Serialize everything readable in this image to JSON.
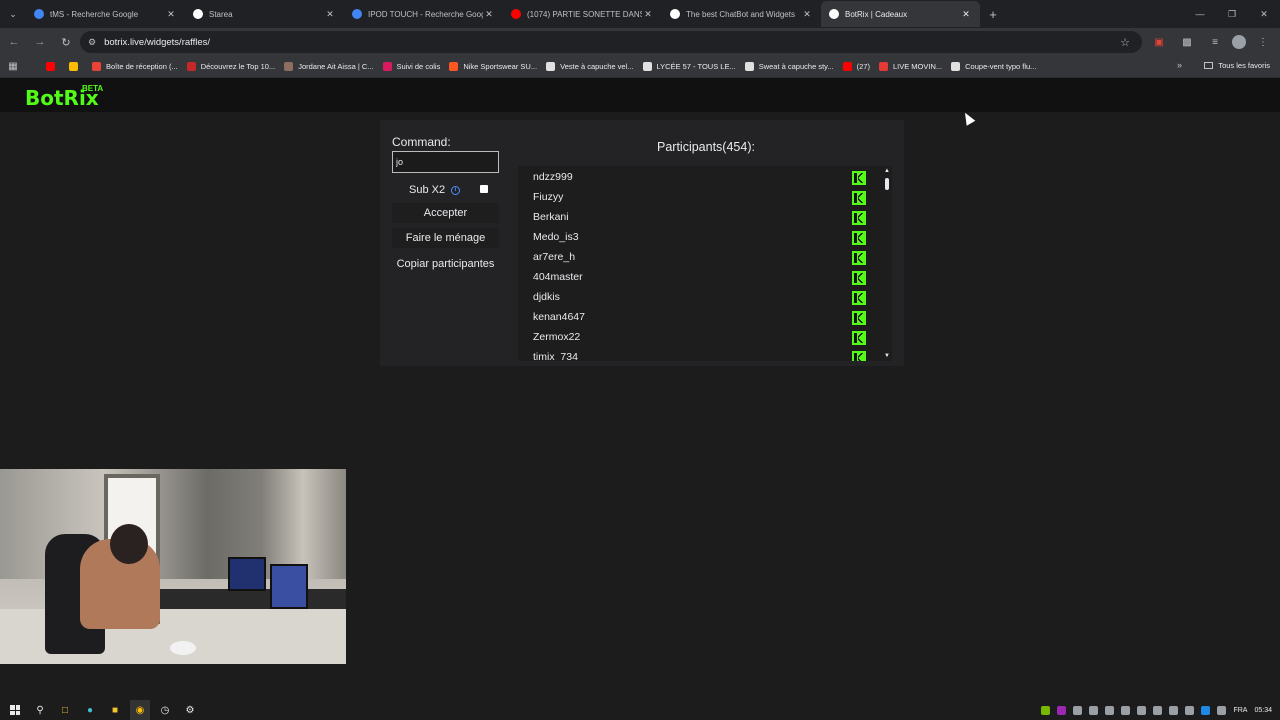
{
  "browser": {
    "tabs": [
      {
        "title": "tMS - Recherche Google",
        "favicon": "google-icon",
        "color": "#4285f4",
        "active": false
      },
      {
        "title": "Starea",
        "favicon": "starea-icon",
        "color": "#ffffff",
        "active": false
      },
      {
        "title": "IPOD TOUCH - Recherche Google",
        "favicon": "google-icon",
        "color": "#4285f4",
        "active": false
      },
      {
        "title": "(1074) PARTIE SONETTE DANS L",
        "favicon": "youtube-icon",
        "color": "#ff0000",
        "active": false
      },
      {
        "title": "The best ChatBot and Widgets",
        "favicon": "botrix-icon",
        "color": "#ffffff",
        "active": false
      },
      {
        "title": "BotRix | Cadeaux",
        "favicon": "botrix-icon",
        "color": "#ffffff",
        "active": true
      }
    ],
    "url": "botrix.live/widgets/raffles/",
    "bookmarks": [
      {
        "label": "",
        "icon": "youtube-icon",
        "color": "#ff0000"
      },
      {
        "label": "",
        "icon": "docs-icon",
        "color": "#fbbc04"
      },
      {
        "label": "Boîte de réception (...",
        "icon": "gmail-icon",
        "color": "#ea4335"
      },
      {
        "label": "Découvrez le Top 10...",
        "icon": "tf-icon",
        "color": "#c62828"
      },
      {
        "label": "Jordane Ait Aissa | C...",
        "icon": "bookmark-icon",
        "color": "#8d6e63"
      },
      {
        "label": "Suivi de colis",
        "icon": "parcel-icon",
        "color": "#d81b60"
      },
      {
        "label": "Nike Sportswear SU...",
        "icon": "nike-icon",
        "color": "#ff5722"
      },
      {
        "label": "Veste à capuche vel...",
        "icon": "page-icon",
        "color": "#e0e0e0"
      },
      {
        "label": "LYCÉE 57 - TOUS LE...",
        "icon": "page-icon",
        "color": "#e0e0e0"
      },
      {
        "label": "Sweat à capuche sty...",
        "icon": "page-icon",
        "color": "#e0e0e0"
      },
      {
        "label": "(27)",
        "icon": "youtube-icon",
        "color": "#ff0000"
      },
      {
        "label": "LIVE MOVIN...",
        "icon": "live-icon",
        "color": "#e53935"
      },
      {
        "label": "Coupe-vent typo flu...",
        "icon": "page-icon",
        "color": "#e0e0e0"
      }
    ],
    "all_bookmarks_label": "Tous les favoris"
  },
  "site": {
    "logo": "BotRix",
    "logo_badge": "BETA",
    "accent": "#53fc18"
  },
  "raffle": {
    "command_label": "Command:",
    "command_value": "jo",
    "sub_x2_label": "Sub X2",
    "accept_label": "Accepter",
    "clean_label": "Faire le ménage",
    "copy_label": "Copiar participantes",
    "participants_title": "Participants(454):",
    "participants": [
      "ndzz999",
      "Fiuzyy",
      "Berkani",
      "Medo_is3",
      "ar7ere_h",
      "404master",
      "djdkis",
      "kenan4647",
      "Zermox22",
      "timix_734"
    ]
  },
  "taskbar": {
    "language": "FRA",
    "time": "05:34"
  }
}
